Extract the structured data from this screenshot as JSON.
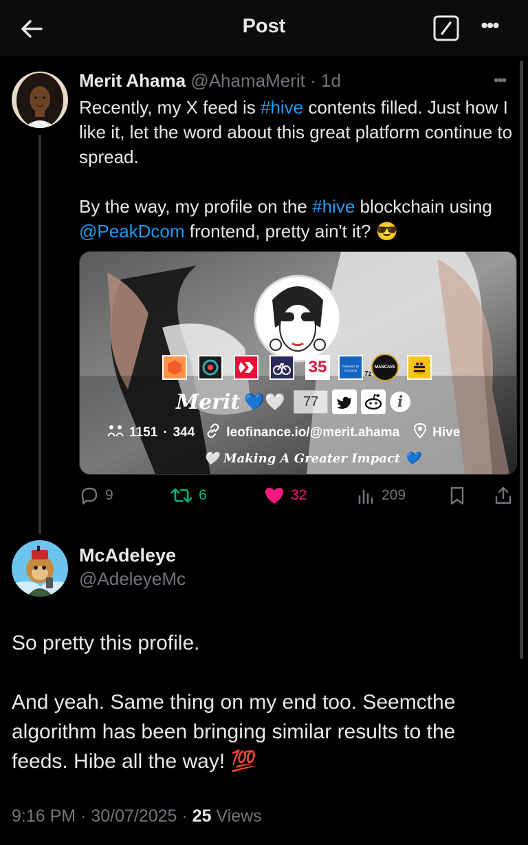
{
  "header": {
    "title": "Post"
  },
  "post": {
    "author_name": "Merit Ahama",
    "author_handle": "@AhamaMerit",
    "separator": " · ",
    "time": "1d",
    "para1_a": "Recently, my X feed is ",
    "para1_hashtag": "#hive",
    "para1_b": " contents filled. Just how I like it, let the word about this great platform continue to spread.",
    "para2_a": "By the way, my profile on the ",
    "para2_hashtag": "#hive",
    "para2_b": " blockchain using ",
    "para2_mention": "@PeakDcom",
    "para2_c": " frontend, pretty ain't it? 😎",
    "media": {
      "profile_name": "Merit",
      "profile_hearts": "💙🤍",
      "reputation": "77",
      "followers": "1151",
      "following": "344",
      "stats_sep": "·",
      "website": "leofinance.io/@merit.ahama",
      "location": "Hive",
      "tagline": "Making A Greater Impact",
      "tagline_prefix": "🤍",
      "tagline_suffix": "💙",
      "badge_35": "35",
      "badge_7z": "7z",
      "badge_referred": "Referred 10 Accounts",
      "badge_mancave": "MANCAVE"
    },
    "actions": {
      "replies": "9",
      "reposts": "6",
      "likes": "32",
      "views": "209"
    }
  },
  "reply": {
    "author_name": "McAdeleye",
    "author_handle": "@AdeleyeMc",
    "para1": "So pretty this profile.",
    "para2": "And yeah. Same thing on my end too. Seemcthe algorithm has been bringing similar results to the feeds. Hibe all the way!  💯",
    "time": "9:16 PM",
    "sep": " · ",
    "date": "30/07/2025",
    "sep2": " · ",
    "views_count": "25",
    "views_label": " Views"
  },
  "colors": {
    "accent": "#1d9bf0",
    "repost": "#00ba7c",
    "like": "#f91880",
    "muted": "#71767b"
  }
}
